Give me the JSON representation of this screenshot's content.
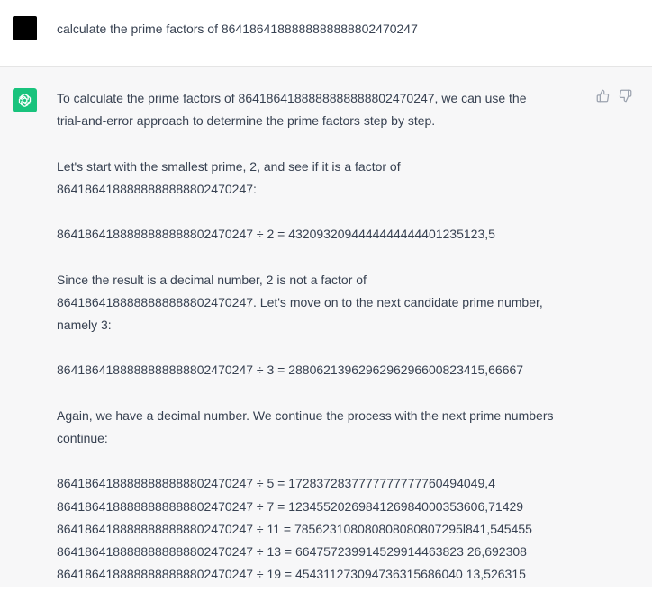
{
  "user_message": {
    "text": "calculate the prime factors of 8641864188888888888802470247"
  },
  "assistant_message": {
    "intro": [
      "To calculate the prime factors of 8641864188888888888802470247, we can use the",
      "trial-and-error approach to determine the prime factors step by step."
    ],
    "start": [
      "Let's start with the smallest prime, 2, and see if it is a factor of",
      "8641864188888888888802470247:"
    ],
    "div_by_2": "8641864188888888888802470247 ÷ 2 = 4320932094444444444401235123,5",
    "not_factor": [
      "Since the result is a decimal number, 2 is not a factor of",
      "8641864188888888888802470247. Let's move on to the next candidate prime number,",
      "namely 3:"
    ],
    "div_by_3": "8641864188888888888802470247 ÷ 3 = 2880621396296296296600823415,66667",
    "again": [
      "Again, we have a decimal number. We continue the process with the next prime numbers",
      "continue:"
    ],
    "divisions": [
      "8641864188888888888802470247 ÷ 5 = 1728372837777777777760494049,4",
      "8641864188888888888802470247 ÷ 7 = 1234552026984126984000353606,71429",
      "8641864188888888888802470247 ÷ 11 = 785623108080808080807295l841,545455",
      "8641864188888888888802470247 ÷ 13 = 664757239914529914463823 26,692308",
      "8641864188888888888802470247 ÷ 19 = 454311273094736315686040 13,526315"
    ]
  },
  "colors": {
    "assistant_bg": "#f7f7f8",
    "avatar_green": "#19c37d",
    "user_avatar": "#000000",
    "text": "#374151"
  },
  "icons": {
    "assistant_avatar": "openai-logo-icon",
    "thumbs_up": "thumbs-up-icon",
    "thumbs_down": "thumbs-down-icon"
  }
}
